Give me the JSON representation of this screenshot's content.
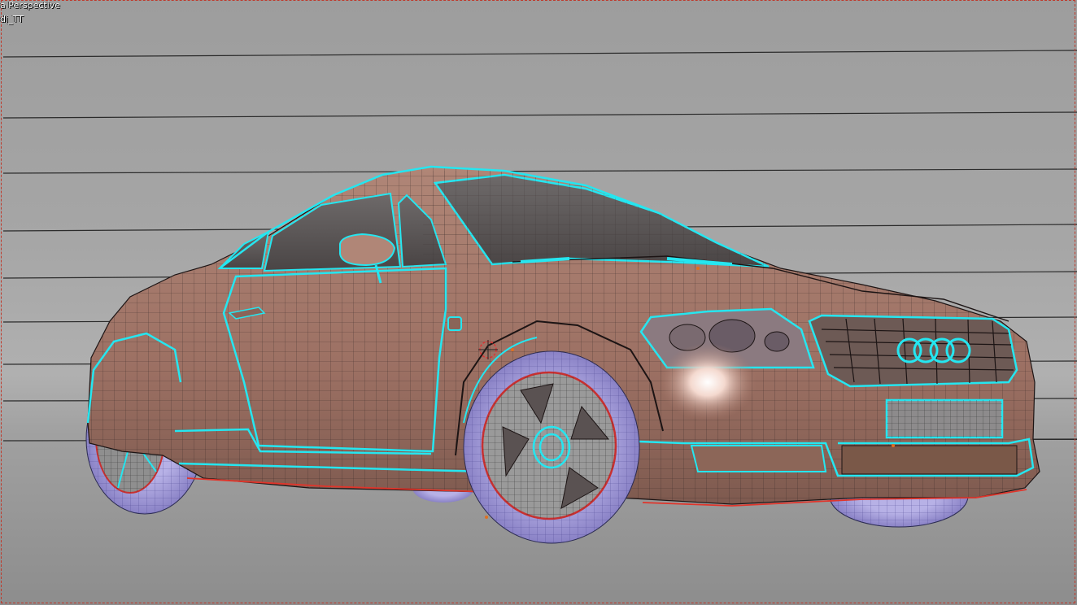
{
  "viewport": {
    "view_label": "a Perspective",
    "object_label": "di_TT"
  },
  "model": {
    "logo_rings": 4
  },
  "colors": {
    "body": "#a87a6c",
    "wire": "#2a2020",
    "edge_highlight": "#25e6f0",
    "tire": "#9a92d8",
    "seam": "#e0352b",
    "background": "#a3a3a3"
  }
}
